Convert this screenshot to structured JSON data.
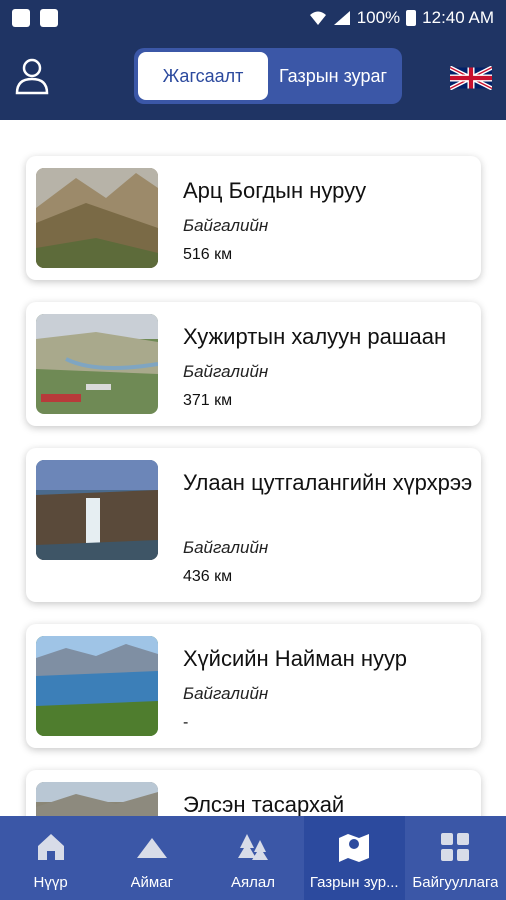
{
  "status_bar": {
    "battery": "100%",
    "time": "12:40 AM"
  },
  "header": {
    "segment": {
      "list_label": "Жагсаалт",
      "map_label": "Газрын зураг",
      "active": "list"
    }
  },
  "items": [
    {
      "title": "Арц Богдын нуруу",
      "category": "Байгалийн",
      "distance": "516 км"
    },
    {
      "title": "Хужиртын халуун рашаан",
      "category": "Байгалийн",
      "distance": "371 км"
    },
    {
      "title": "Улаан цутгалангийн хүрхрээ",
      "category": "Байгалийн",
      "distance": "436 км"
    },
    {
      "title": "Хүйсийн Найман нуур",
      "category": "Байгалийн",
      "distance": "-"
    },
    {
      "title": "Элсэн тасархай",
      "category": "",
      "distance": ""
    }
  ],
  "tabs": [
    {
      "label": "Нүүр",
      "icon": "home-icon"
    },
    {
      "label": "Аймаг",
      "icon": "mountain-icon"
    },
    {
      "label": "Аялал",
      "icon": "trees-icon"
    },
    {
      "label": "Газрын зур...",
      "icon": "map-icon",
      "active": true
    },
    {
      "label": "Байгууллага",
      "icon": "grid-icon"
    }
  ],
  "colors": {
    "header": "#1f3464",
    "accent": "#3b57a7",
    "active_tab": "#2c4a9e"
  }
}
